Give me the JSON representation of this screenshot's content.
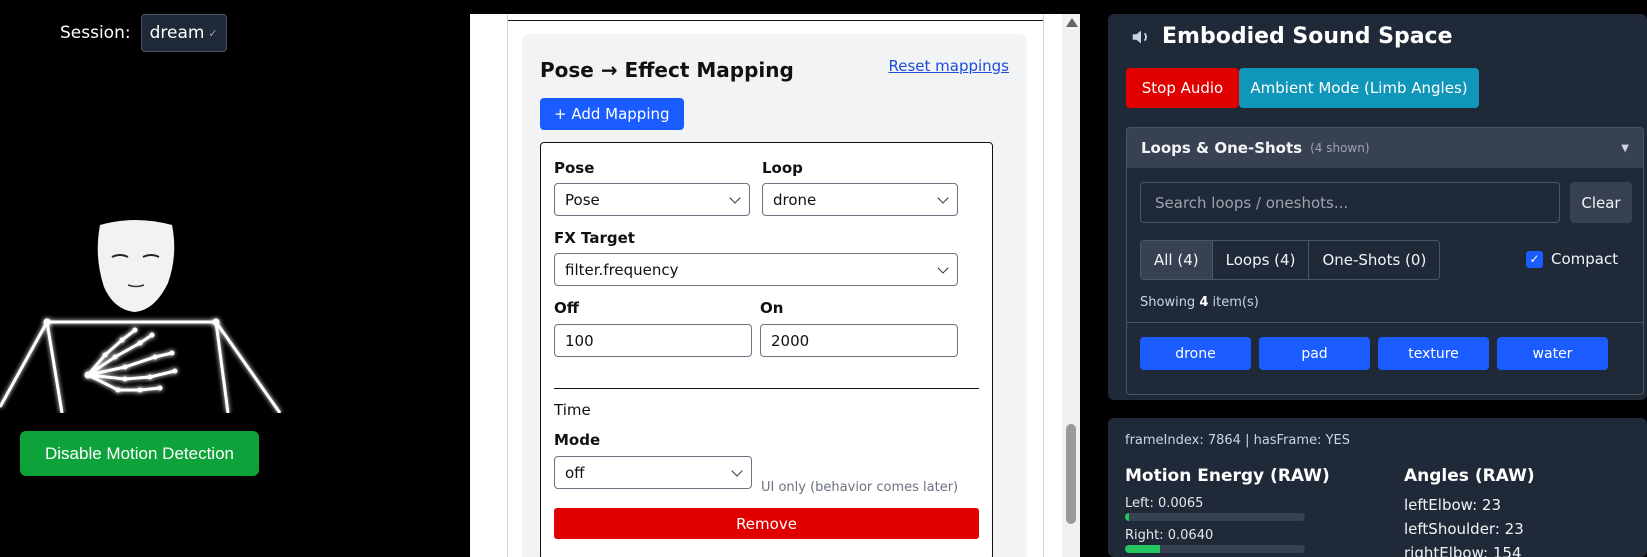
{
  "session": {
    "label": "Session:",
    "value": "dream"
  },
  "motion_button": "Disable Motion Detection",
  "mapping": {
    "title": "Pose → Effect Mapping",
    "reset_label": "Reset mappings",
    "add_label": "+ Add Mapping",
    "pose_label": "Pose",
    "pose_value": "Pose",
    "loop_label": "Loop",
    "loop_value": "drone",
    "fx_label": "FX Target",
    "fx_value": "filter.frequency",
    "off_label": "Off",
    "off_value": "100",
    "on_label": "On",
    "on_value": "2000",
    "time_label": "Time",
    "mode_label": "Mode",
    "mode_value": "off",
    "mode_hint": "UI only (behavior comes later)",
    "remove_label": "Remove"
  },
  "sound": {
    "title": "Embodied Sound Space",
    "stop_label": "Stop Audio",
    "ambient_label": "Ambient Mode (Limb Angles)",
    "loops_title": "Loops & One-Shots",
    "loops_count": "(4 shown)",
    "search_placeholder": "Search loops / oneshots...",
    "clear_label": "Clear",
    "filters": [
      "All (4)",
      "Loops (4)",
      "One-Shots (0)"
    ],
    "compact_label": "Compact",
    "compact_checked": true,
    "showing_prefix": "Showing",
    "showing_count": "4",
    "showing_suffix": "item(s)",
    "chips": [
      "drone",
      "pad",
      "texture",
      "water"
    ]
  },
  "debug": {
    "frame_info": "frameIndex: 7864 | hasFrame: YES",
    "energy_title": "Motion Energy (RAW)",
    "left_label": "Left: 0.0065",
    "left_level": 0.0065,
    "right_label": "Right: 0.0640",
    "right_level": 0.064,
    "angles_title": "Angles (RAW)",
    "angles": [
      "leftElbow: 23",
      "leftShoulder: 23",
      "rightElbow: 154"
    ]
  },
  "colors": {
    "accent": "#1a5cff",
    "danger": "#e00000",
    "success": "#0ea33a",
    "ambient": "#1096b8",
    "panel": "#1f2937"
  },
  "icons": {
    "speaker": "speaker-icon",
    "select_chevron": "chevron-down-icon",
    "collapse": "caret-down-icon",
    "check": "checkmark-icon"
  }
}
